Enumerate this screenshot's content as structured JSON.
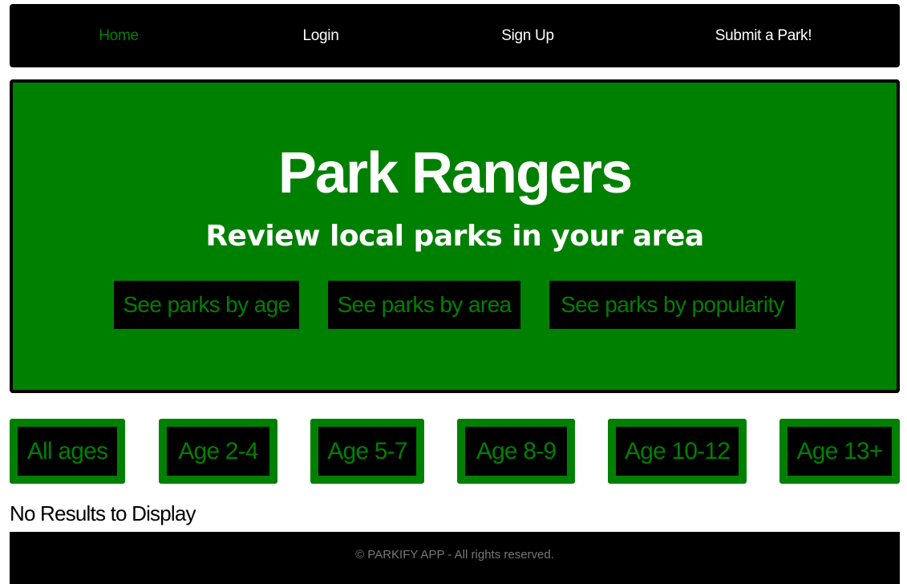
{
  "nav": {
    "items": [
      {
        "label": "Home",
        "active": true
      },
      {
        "label": "Login",
        "active": false
      },
      {
        "label": "Sign Up",
        "active": false
      },
      {
        "label": "Submit a Park!",
        "active": false
      }
    ]
  },
  "hero": {
    "title": "Park Rangers",
    "subtitle": "Review local parks in your area",
    "buttons": [
      {
        "label": "See parks by age"
      },
      {
        "label": "See parks by area"
      },
      {
        "label": "See parks by popularity"
      }
    ]
  },
  "age_filters": [
    {
      "label": "All ages"
    },
    {
      "label": "Age 2-4"
    },
    {
      "label": "Age 5-7"
    },
    {
      "label": "Age 8-9"
    },
    {
      "label": "Age 10-12"
    },
    {
      "label": "Age 13+"
    }
  ],
  "results": {
    "empty_message": "No Results to Display"
  },
  "footer": {
    "text": "© PARKIFY APP - All rights reserved."
  },
  "colors": {
    "accent": "#008000",
    "dark": "#000000",
    "text_light": "#ffffff",
    "footer_text": "#777777"
  }
}
